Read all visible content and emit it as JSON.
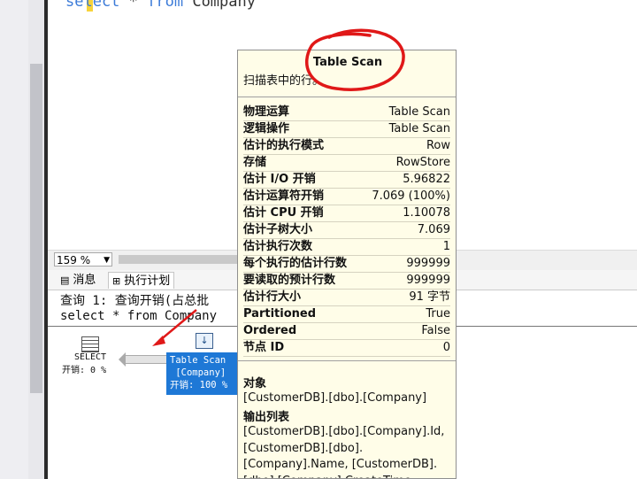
{
  "editor": {
    "query_keyword_select": "select",
    "query_star": " * ",
    "query_keyword_from": "from",
    "query_table": " Company"
  },
  "zoom": {
    "value": "159 %"
  },
  "tabs": [
    {
      "label": "消息",
      "icon": "messages-icon"
    },
    {
      "label": "执行计划",
      "icon": "execution-plan-icon"
    }
  ],
  "result": {
    "query_header": "查询 1: 查询开销(占总批",
    "query_text": "select * from Company"
  },
  "plan": {
    "select_node": {
      "label": "SELECT",
      "cost": "开销: 0 %",
      "icon": "select-grid-icon"
    },
    "scan_node": {
      "line1": "Table Scan",
      "line2": " [Company]",
      "line3": "开销: 100 %",
      "icon": "table-scan-icon"
    }
  },
  "tooltip": {
    "title": "Table Scan",
    "description": "扫描表中的行。",
    "rows": [
      {
        "key": "物理运算",
        "value": "Table Scan"
      },
      {
        "key": "逻辑操作",
        "value": "Table Scan"
      },
      {
        "key": "估计的执行模式",
        "value": "Row"
      },
      {
        "key": "存储",
        "value": "RowStore"
      },
      {
        "key": "估计 I/O 开销",
        "value": "5.96822"
      },
      {
        "key": "估计运算符开销",
        "value": "7.069 (100%)"
      },
      {
        "key": "估计 CPU 开销",
        "value": "1.10078"
      },
      {
        "key": "估计子树大小",
        "value": "7.069"
      },
      {
        "key": "估计执行次数",
        "value": "1"
      },
      {
        "key": "每个执行的估计行数",
        "value": "999999"
      },
      {
        "key": "要读取的预计行数",
        "value": "999999"
      },
      {
        "key": "估计行大小",
        "value": "91 字节"
      },
      {
        "key": "Partitioned",
        "value": "True"
      },
      {
        "key": "Ordered",
        "value": "False"
      },
      {
        "key": "节点 ID",
        "value": "0"
      }
    ],
    "object_heading": "对象",
    "object_value": "[CustomerDB].[dbo].[Company]",
    "output_heading": "输出列表",
    "output_value": "[CustomerDB].[dbo].[Company].Id, [CustomerDB].[dbo].[Company].Name, [CustomerDB].[dbo].[Company].CreateTime"
  },
  "colors": {
    "annotation_red": "#e01818",
    "selected_node": "#1e78d6",
    "tooltip_bg": "#fffde8"
  }
}
